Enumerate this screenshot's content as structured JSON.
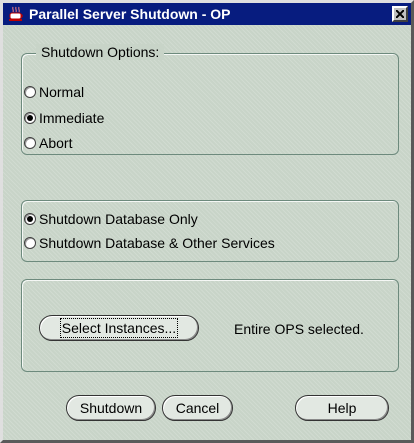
{
  "window": {
    "title": "Parallel Server Shutdown - OP"
  },
  "shutdown_options": {
    "legend": "Shutdown Options:",
    "options": [
      {
        "label": "Normal",
        "selected": false
      },
      {
        "label": "Immediate",
        "selected": true
      },
      {
        "label": "Abort",
        "selected": false
      }
    ]
  },
  "scope": {
    "options": [
      {
        "label": "Shutdown Database Only",
        "selected": true
      },
      {
        "label": "Shutdown Database & Other Services",
        "selected": false
      }
    ]
  },
  "instances": {
    "button_label": "Select Instances...",
    "status": "Entire OPS selected."
  },
  "footer": {
    "shutdown_label": "Shutdown",
    "cancel_label": "Cancel",
    "help_label": "Help"
  },
  "icons": {
    "app": "coffee-cup-icon",
    "close": "close-icon"
  },
  "colors": {
    "titlebar": "#071c7f",
    "dialog_background": "#c8d4c8",
    "group_border": "#6d8a7d"
  }
}
